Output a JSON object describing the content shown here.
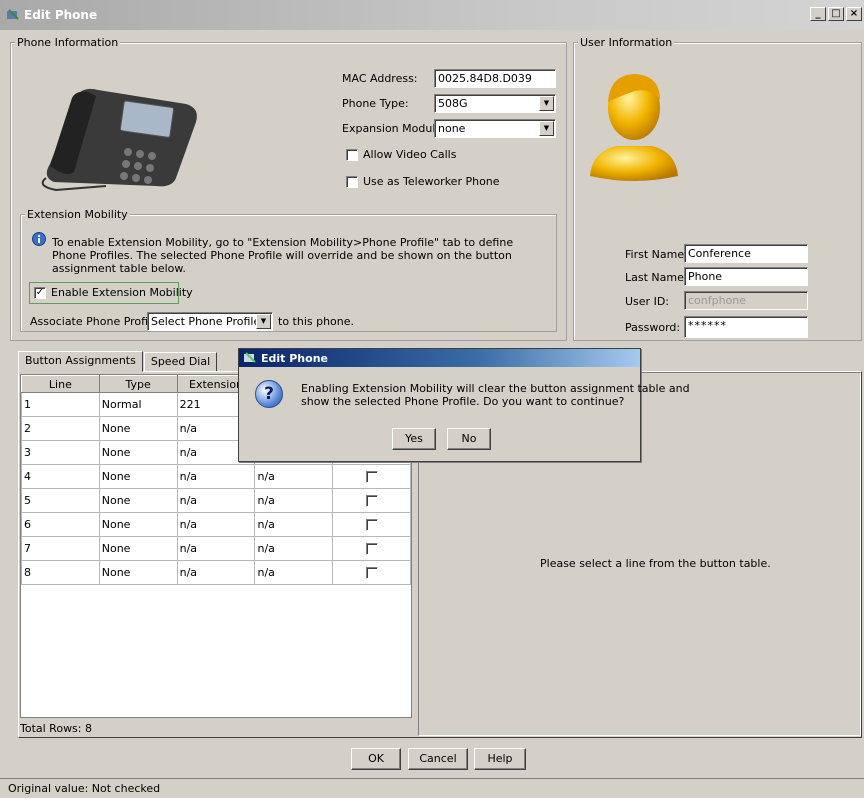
{
  "window": {
    "title": "Edit Phone",
    "controls": [
      "_",
      "□",
      "×"
    ]
  },
  "phone_info": {
    "legend": "Phone Information",
    "mac_label": "MAC Address:",
    "mac_value": "0025.84D8.D039",
    "type_label": "Phone Type:",
    "type_value": "508G",
    "expansion_label": "Expansion Module:",
    "expansion_value": "none",
    "allow_video_label": "Allow Video Calls",
    "allow_video_checked": false,
    "teleworker_label": "Use as Teleworker Phone",
    "teleworker_checked": false
  },
  "extension_mobility": {
    "legend": "Extension Mobility",
    "info_line1": "To enable Extension Mobility, go to \"Extension Mobility>Phone Profile\" tab to define",
    "info_line2": "Phone Profiles. The selected Phone Profile will override and be shown on the button",
    "info_line3": "assignment table below.",
    "enable_label": "Enable Extension Mobility",
    "enable_checked": true,
    "check_mark": "✓",
    "associate_label": "Associate Phone Profile",
    "profile_value": "Select Phone Profile",
    "suffix_label": "to this phone."
  },
  "user_info": {
    "legend": "User Information",
    "first_name_label": "First Name:",
    "first_name_value": "Conference",
    "last_name_label": "Last Name:",
    "last_name_value": "Phone",
    "user_id_label": "User ID:",
    "user_id_value": "confphone",
    "password_label": "Password:",
    "password_value": "******"
  },
  "tabs": [
    {
      "label": "Button Assignments",
      "active": true
    },
    {
      "label": "Speed Dial",
      "active": false
    }
  ],
  "table": {
    "headers": [
      "Line",
      "Type",
      "Extension",
      "",
      ""
    ],
    "rows": [
      {
        "line": "1",
        "type": "Normal",
        "extension": "221",
        "col4": "",
        "checkbox": false
      },
      {
        "line": "2",
        "type": "None",
        "extension": "n/a",
        "col4": "",
        "checkbox": false
      },
      {
        "line": "3",
        "type": "None",
        "extension": "n/a",
        "col4": "",
        "checkbox": false
      },
      {
        "line": "4",
        "type": "None",
        "extension": "n/a",
        "col4": "n/a",
        "checkbox": false
      },
      {
        "line": "5",
        "type": "None",
        "extension": "n/a",
        "col4": "n/a",
        "checkbox": false
      },
      {
        "line": "6",
        "type": "None",
        "extension": "n/a",
        "col4": "n/a",
        "checkbox": false
      },
      {
        "line": "7",
        "type": "None",
        "extension": "n/a",
        "col4": "n/a",
        "checkbox": false
      },
      {
        "line": "8",
        "type": "None",
        "extension": "n/a",
        "col4": "n/a",
        "checkbox": false
      }
    ],
    "total_rows": "Total Rows: 8"
  },
  "detail": {
    "message": "Please select a line from the button table."
  },
  "buttons": {
    "ok": "OK",
    "cancel": "Cancel",
    "help": "Help"
  },
  "status": {
    "text": "Original value: Not checked"
  },
  "dialog": {
    "title": "Edit Phone",
    "icon": "?",
    "message_line1": "Enabling Extension Mobility will clear the button assignment table and",
    "message_line2": "show the selected Phone Profile. Do you want to continue?",
    "yes": "Yes",
    "no": "No"
  },
  "colors": {
    "window_bg": "#d4d0c8",
    "dialog_title": "#0a246a",
    "highlight_border": "#5aa05a"
  }
}
